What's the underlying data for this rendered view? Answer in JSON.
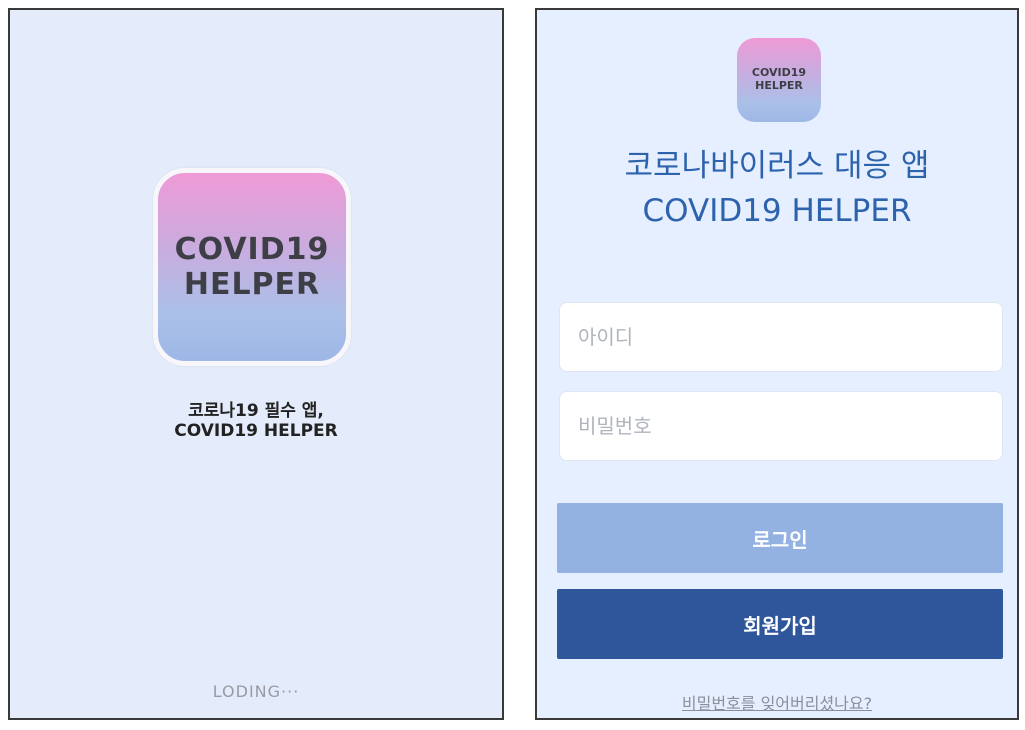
{
  "splash": {
    "logo_line1": "COVID19",
    "logo_line2": "HELPER",
    "tagline_line1": "코로나19 필수 앱,",
    "tagline_line2": "COVID19 HELPER",
    "loading_text": "LODING···"
  },
  "login": {
    "logo_line1": "COVID19",
    "logo_line2": "HELPER",
    "title_line1": "코로나바이러스 대응 앱",
    "title_line2": "COVID19 HELPER",
    "id_placeholder": "아이디",
    "password_placeholder": "비밀번호",
    "login_button": "로그인",
    "signup_button": "회원가입",
    "forgot_link": "비밀번호를 잊어버리셨나요?"
  },
  "colors": {
    "background": "#e4ecfb",
    "title_blue": "#2d63ad",
    "login_button": "#93b1e1",
    "signup_button": "#2f569b",
    "logo_gradient_top": "#ef9ad6",
    "logo_gradient_bottom": "#9db7e6"
  }
}
